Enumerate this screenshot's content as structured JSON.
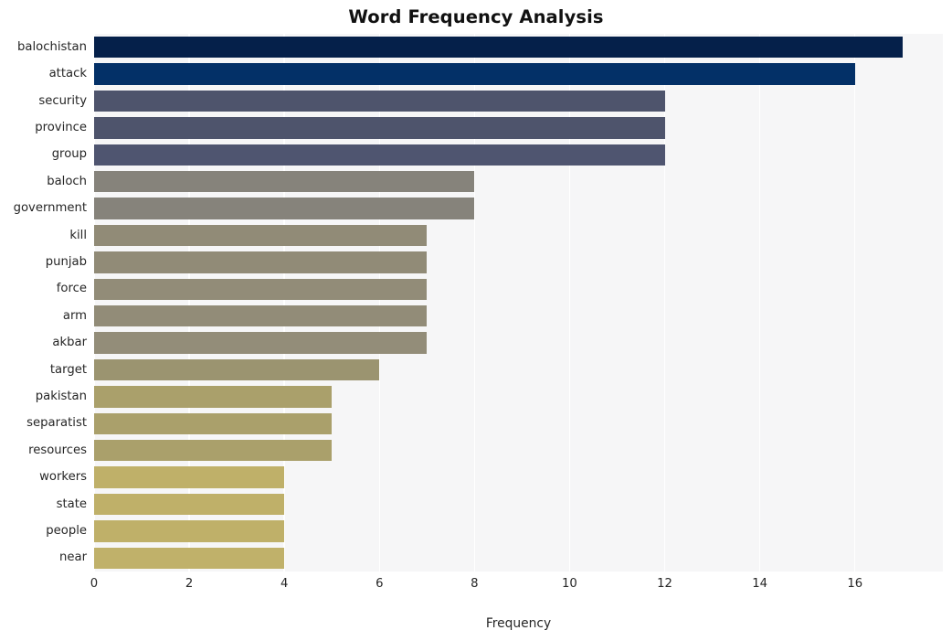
{
  "chart_data": {
    "type": "bar",
    "orientation": "horizontal",
    "title": "Word Frequency Analysis",
    "xlabel": "Frequency",
    "ylabel": "",
    "xlim": [
      0,
      17.85
    ],
    "ylim_categories": 20,
    "grid": "vertical-only",
    "legend": "none",
    "background": "#f6f6f7",
    "gridline_color": "#ffffff",
    "xticks": [
      0,
      2,
      4,
      6,
      8,
      10,
      12,
      14,
      16
    ],
    "categories": [
      "balochistan",
      "attack",
      "security",
      "province",
      "group",
      "baloch",
      "government",
      "kill",
      "punjab",
      "force",
      "arm",
      "akbar",
      "target",
      "pakistan",
      "separatist",
      "resources",
      "workers",
      "state",
      "people",
      "near"
    ],
    "values": [
      17,
      16,
      12,
      12,
      12,
      8,
      8,
      7,
      7,
      7,
      7,
      7,
      6,
      5,
      5,
      5,
      4,
      4,
      4,
      4
    ],
    "bar_colors": [
      "#05204a",
      "#033067",
      "#4e546c",
      "#4e546c",
      "#4f5570",
      "#86837b",
      "#86837b",
      "#918b77",
      "#918b77",
      "#928c78",
      "#928c78",
      "#938d79",
      "#9b9470",
      "#aaa06b",
      "#aaa06b",
      "#aaa06b",
      "#bfb069",
      "#bfb069",
      "#bfb069",
      "#c0b16a"
    ]
  }
}
